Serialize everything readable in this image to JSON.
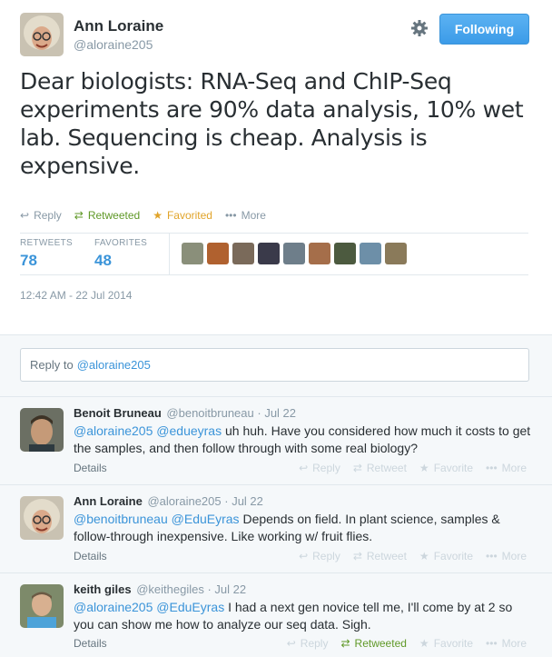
{
  "author": {
    "name": "Ann Loraine",
    "handle": "@aloraine205"
  },
  "follow_button": "Following",
  "tweet": {
    "text": "Dear biologists: RNA-Seq and ChIP-Seq experiments are 90% data analysis, 10% wet lab. Sequencing is cheap. Analysis is expensive."
  },
  "actions": {
    "reply": "Reply",
    "retweeted": "Retweeted",
    "favorited": "Favorited",
    "more": "More"
  },
  "stats": {
    "retweets_label": "RETWEETS",
    "retweets": "78",
    "favorites_label": "FAVORITES",
    "favorites": "48"
  },
  "timestamp": "12:42 AM - 22 Jul 2014",
  "reply_box": {
    "prefix": "Reply to",
    "mention": "@aloraine205"
  },
  "replies": [
    {
      "name": "Benoit Bruneau",
      "handle": "@benoitbruneau",
      "time": "· Jul 22",
      "m1": "@aloraine205",
      "m2": "@edueyras",
      "text": " uh huh. Have you considered how much it costs to get the samples, and then follow through with some real biology?",
      "details": "Details",
      "reply": "Reply",
      "retweet": "Retweet",
      "favorite": "Favorite",
      "more": "More"
    },
    {
      "name": "Ann Loraine",
      "handle": "@aloraine205",
      "time": "· Jul 22",
      "m1": "@benoitbruneau",
      "m2": "@EduEyras",
      "text": " Depends on field. In plant science, samples & follow-through inexpensive. Like working w/ fruit flies.",
      "details": "Details",
      "reply": "Reply",
      "retweet": "Retweet",
      "favorite": "Favorite",
      "more": "More"
    },
    {
      "name": "keith giles",
      "handle": "@keithegiles",
      "time": "· Jul 22",
      "m1": "@aloraine205",
      "m2": "@EduEyras",
      "text": " I had a next gen novice tell me, I'll come by at 2 so you can show me how to analyze our seq data. Sigh.",
      "details": "Details",
      "reply": "Reply",
      "retweet": "Retweeted",
      "favorite": "Favorite",
      "more": "More"
    }
  ],
  "colors": {
    "link": "#3b94d9",
    "retweet": "#609928",
    "favorite": "#e1a42a",
    "muted": "#8899a6"
  }
}
